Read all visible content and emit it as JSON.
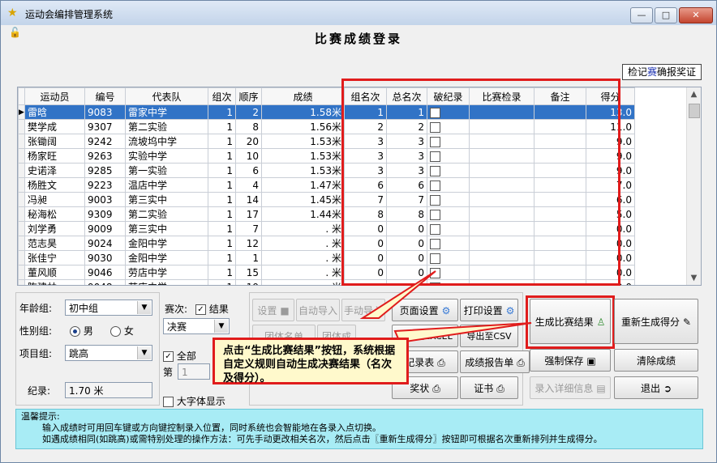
{
  "window": {
    "title": "运动会编排管理系统",
    "min": "—",
    "max": "□",
    "close": "✕"
  },
  "page_title": "比赛成绩登录",
  "award_btn": {
    "part1": "检记",
    "part2": "赛",
    "part3": "确报奖证"
  },
  "grid": {
    "columns": [
      "运动员",
      "编号",
      "代表队",
      "组次",
      "顺序",
      "成绩",
      "组名次",
      "总名次",
      "破纪录",
      "比赛检录",
      "备注",
      "得分"
    ],
    "rows": [
      {
        "name": "雷晗",
        "id": "9083",
        "team": "雷家中学",
        "group": "1",
        "order": "2",
        "score": "1.58米",
        "grank": "1",
        "trank": "1",
        "points": "13.0"
      },
      {
        "name": "樊学成",
        "id": "9307",
        "team": "第二实验",
        "group": "1",
        "order": "8",
        "score": "1.56米",
        "grank": "2",
        "trank": "2",
        "points": "11.0"
      },
      {
        "name": "张锄阔",
        "id": "9242",
        "team": "流坡坞中学",
        "group": "1",
        "order": "20",
        "score": "1.53米",
        "grank": "3",
        "trank": "3",
        "points": "9.0"
      },
      {
        "name": "杨家旺",
        "id": "9263",
        "team": "实验中学",
        "group": "1",
        "order": "10",
        "score": "1.53米",
        "grank": "3",
        "trank": "3",
        "points": "9.0"
      },
      {
        "name": "史诺泽",
        "id": "9285",
        "team": "第一实验",
        "group": "1",
        "order": "6",
        "score": "1.53米",
        "grank": "3",
        "trank": "3",
        "points": "9.0"
      },
      {
        "name": "杨胜文",
        "id": "9223",
        "team": "温店中学",
        "group": "1",
        "order": "4",
        "score": "1.47米",
        "grank": "6",
        "trank": "6",
        "points": "7.0"
      },
      {
        "name": "冯昶",
        "id": "9003",
        "team": "第三实中",
        "group": "1",
        "order": "14",
        "score": "1.45米",
        "grank": "7",
        "trank": "7",
        "points": "6.0"
      },
      {
        "name": "秘海松",
        "id": "9309",
        "team": "第二实验",
        "group": "1",
        "order": "17",
        "score": "1.44米",
        "grank": "8",
        "trank": "8",
        "points": "5.0"
      },
      {
        "name": "刘学勇",
        "id": "9009",
        "team": "第三实中",
        "group": "1",
        "order": "7",
        "score": ". 米",
        "grank": "0",
        "trank": "0",
        "points": "0.0"
      },
      {
        "name": "范志昊",
        "id": "9024",
        "team": "金阳中学",
        "group": "1",
        "order": "12",
        "score": ". 米",
        "grank": "0",
        "trank": "0",
        "points": "0.0"
      },
      {
        "name": "张佳宁",
        "id": "9030",
        "team": "金阳中学",
        "group": "1",
        "order": "1",
        "score": ". 米",
        "grank": "0",
        "trank": "0",
        "points": "0.0"
      },
      {
        "name": "董风顺",
        "id": "9046",
        "team": "劳店中学",
        "group": "1",
        "order": "15",
        "score": ". 米",
        "grank": "0",
        "trank": "0",
        "points": "0.0"
      },
      {
        "name": "陈建林",
        "id": "9048",
        "team": "劳店中学",
        "group": "1",
        "order": "19",
        "score": ". 米",
        "grank": "0",
        "trank": "0",
        "points": "0.0"
      }
    ]
  },
  "filters": {
    "age_label": "年龄组:",
    "age_value": "初中组",
    "gender_label": "性别组:",
    "male": "男",
    "female": "女",
    "event_label": "项目组:",
    "event_value": "跳高",
    "record_label": "纪录:",
    "record_value": "1.70 米"
  },
  "round": {
    "label": "赛次:",
    "result_label": "结果",
    "value": "决赛",
    "all_label": "全部",
    "page_label": "第",
    "page_value": "1",
    "bigfont_label": "大字体显示"
  },
  "buttons": {
    "settings": "设置",
    "auto_import": "自动导入",
    "manual_import": "手动导入",
    "team_list": "团体名单",
    "team_score": "团体成",
    "page_setup": "页面设置",
    "print_setup": "打印设置",
    "export_excel": "导出至EXCEL",
    "export_csv": "导出至CSV",
    "record_table": "纪录表",
    "result_report": "成绩报告单",
    "award": "奖状",
    "certificate": "证书",
    "generate": "生成比赛结果",
    "regen": "重新生成得分",
    "force_save": "强制保存",
    "clear": "清除成绩",
    "entry_detail": "录入详细信息",
    "exit": "退出"
  },
  "callout": "点击“生成比赛结果”按钮，系统根据自定义规则自动生成决赛结果（名次及得分）。",
  "hint": {
    "title": "温馨提示:",
    "line1": "输入成绩时可用回车键或方向键控制录入位置，同时系统也会智能地在各录入点切换。",
    "line2": "如遇成绩相同(如跳高)或需特别处理的操作方法：可先手动更改相关名次，然后点击〖重新生成得分〗按钮即可根据名次重新排列并生成得分。"
  }
}
